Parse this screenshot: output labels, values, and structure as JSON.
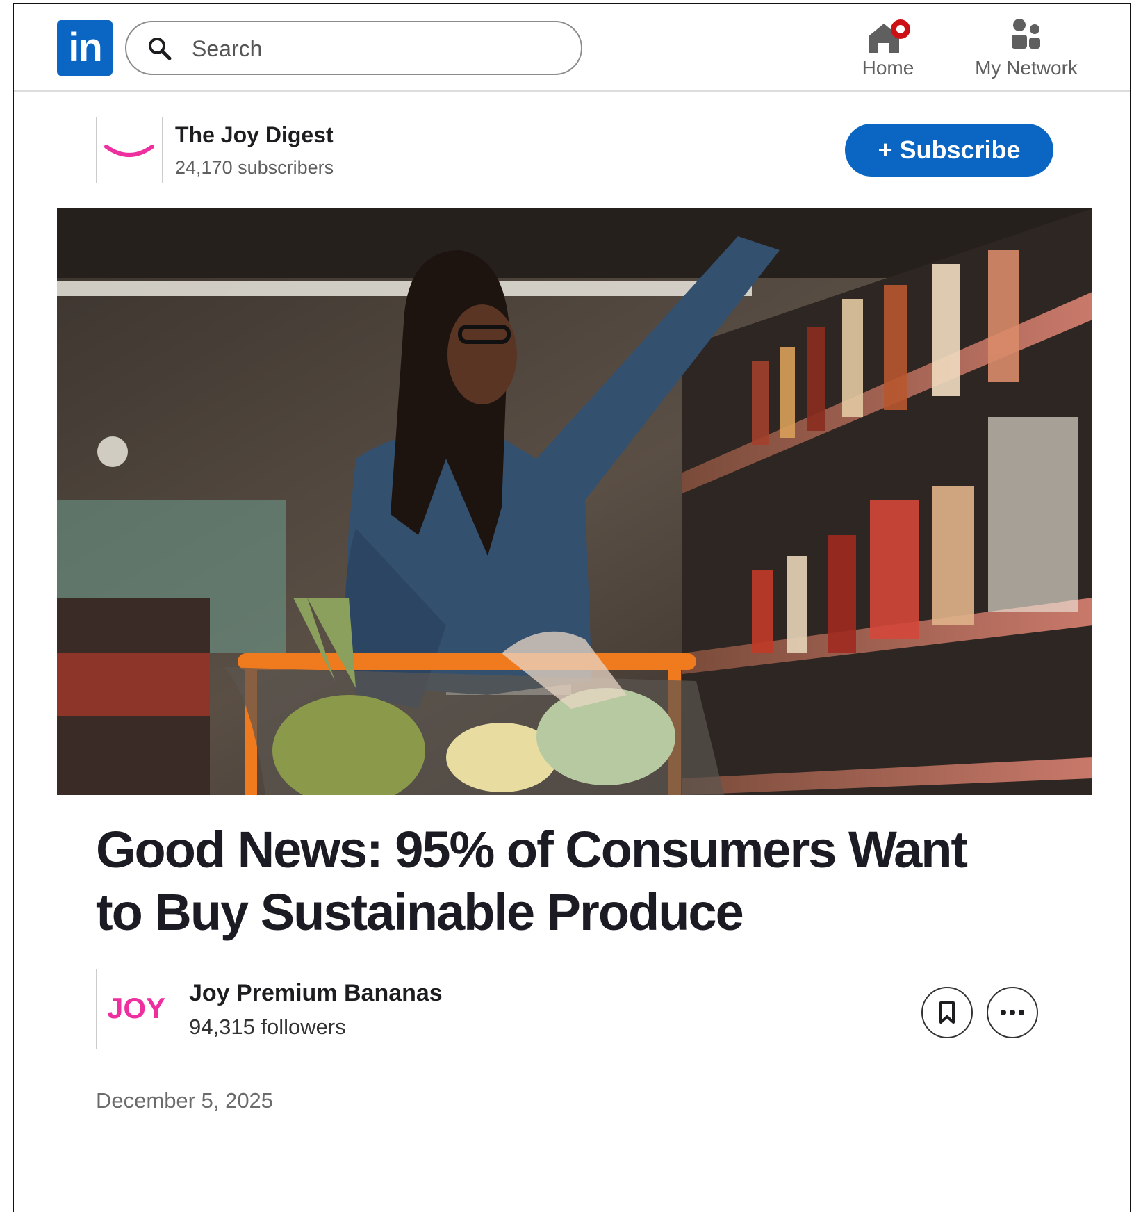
{
  "topnav": {
    "logo_text": "in",
    "search": {
      "placeholder": "Search",
      "icon": "search-icon"
    },
    "items": [
      {
        "label": "Home",
        "icon": "home-icon",
        "has_notification": true
      },
      {
        "label": "My Network",
        "icon": "people-icon"
      }
    ]
  },
  "newsletter": {
    "title": "The Joy Digest",
    "subscribers": "24,170 subscribers",
    "subscribe_label": "+ Subscribe"
  },
  "article": {
    "hero_image": "woman-reaching-grocery-shelf-with-cart",
    "headline": "Good News: 95% of Consumers Want to Buy Sustainable Produce",
    "author": {
      "logo_text": "JOY",
      "name": "Joy Premium Bananas",
      "followers": "94,315 followers"
    },
    "date": "December 5, 2025"
  },
  "colors": {
    "brand_blue": "#0a66c2",
    "joy_pink": "#ee2fa0",
    "notification_red": "#cc1016"
  }
}
